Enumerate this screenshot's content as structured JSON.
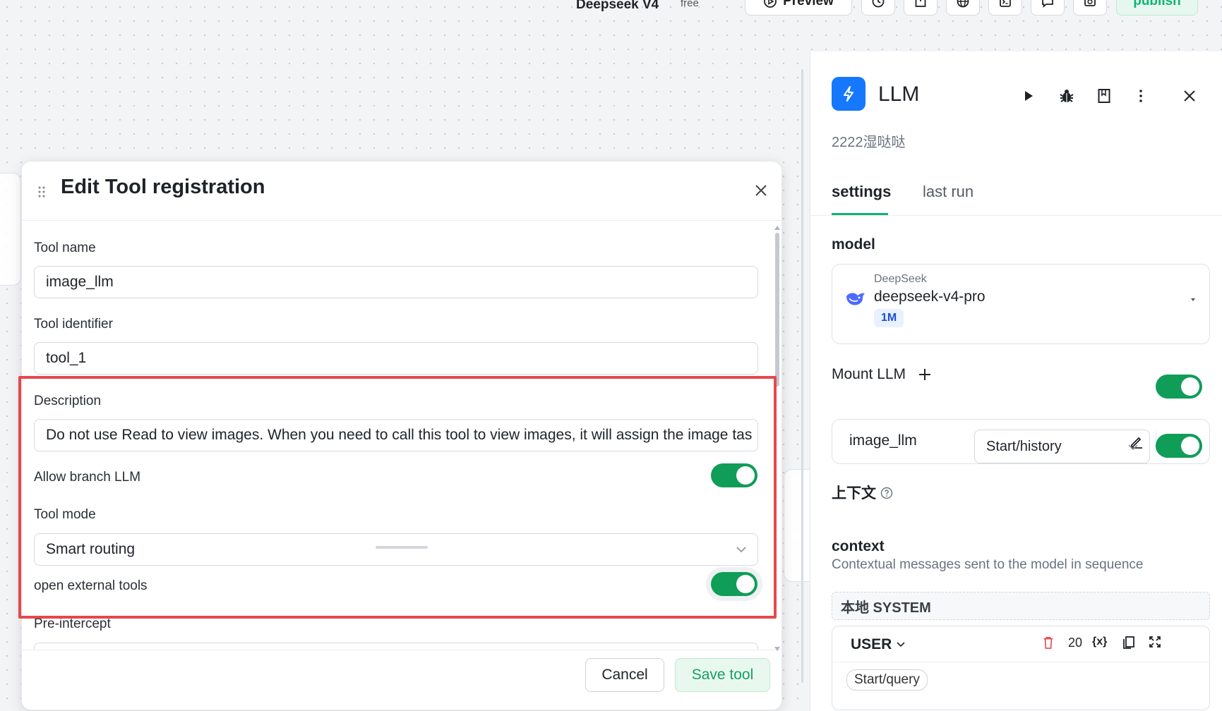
{
  "topbar": {
    "app_title": "Deepseek V4",
    "plan": "free",
    "preview_label": "Preview",
    "publish_label": "publish"
  },
  "modal": {
    "title": "Edit Tool registration",
    "fields": {
      "tool_name_label": "Tool name",
      "tool_name_value": "image_llm",
      "tool_identifier_label": "Tool identifier",
      "tool_identifier_value": "tool_1",
      "description_label": "Description",
      "description_value": "Do not use Read to view images. When you need to call this tool to view images, it will assign the image tas",
      "allow_branch_label": "Allow branch LLM",
      "allow_branch_on": true,
      "tool_mode_label": "Tool mode",
      "tool_mode_value": "Smart routing",
      "open_external_label": "open external tools",
      "open_external_on": true,
      "pre_intercept_label": "Pre-intercept"
    },
    "cancel_label": "Cancel",
    "save_label": "Save tool"
  },
  "panel": {
    "title": "LLM",
    "subtitle": "2222湿哒哒",
    "tabs": [
      {
        "label": "settings",
        "active": true
      },
      {
        "label": "last run",
        "active": false
      }
    ],
    "model_label": "model",
    "model": {
      "provider": "DeepSeek",
      "name": "deepseek-v4-pro",
      "context_badge": "1M"
    },
    "mount_llm_label": "Mount LLM",
    "mount_llm_on": true,
    "mounted_tool": "image_llm",
    "context_cn_label": "上下文",
    "context_select": "Start/history",
    "context_on": true,
    "context_label": "context",
    "context_desc": "Contextual messages sent to the model in sequence",
    "system_label": "本地 SYSTEM",
    "user_label": "USER",
    "user_count": "20",
    "var_icon_text": "{x}",
    "user_chip": "Start/query"
  },
  "colors": {
    "accent_green": "#10b472",
    "toggle_green": "#0f9d58",
    "highlight_red": "#e5484d",
    "llm_blue": "#1677ff",
    "delete_red": "#e5484d"
  }
}
